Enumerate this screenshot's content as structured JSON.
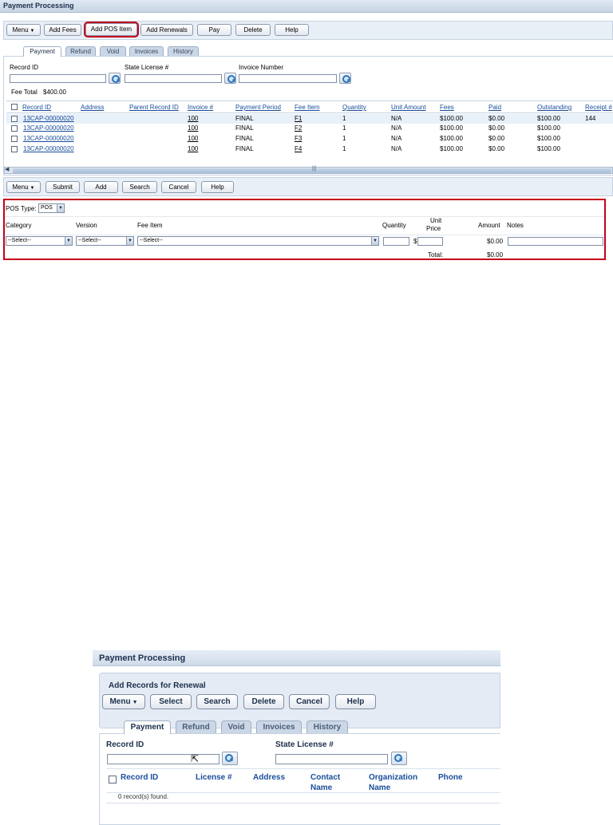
{
  "top": {
    "title": "Payment Processing",
    "toolbar": {
      "menu": "Menu",
      "add_fees": "Add Fees",
      "add_pos_item": "Add POS Item",
      "add_renewals": "Add Renewals",
      "pay": "Pay",
      "delete": "Delete",
      "help": "Help"
    },
    "tabs": [
      "Payment",
      "Refund",
      "Void",
      "Invoices",
      "History"
    ],
    "search": {
      "record_id_label": "Record ID",
      "state_license_label": "State License #",
      "invoice_number_label": "Invoice Number"
    },
    "fee_total_label": "Fee Total",
    "fee_total_value": "$400.00",
    "table": {
      "headers": [
        "Record ID",
        "Address",
        "Parent Record ID",
        "Invoice #",
        "Payment Period",
        "Fee Item",
        "Quantity",
        "Unit Amount",
        "Fees",
        "Paid",
        "Outstanding",
        "Receipt #"
      ],
      "rows": [
        {
          "record_id": "13CAP-00000020",
          "address": "",
          "parent": "",
          "invoice": "100",
          "period": "FINAL",
          "fee_item": "F1",
          "quantity": "1",
          "unit_amount": "N/A",
          "fees": "$100.00",
          "paid": "$0.00",
          "outstanding": "$100.00",
          "receipt": "144"
        },
        {
          "record_id": "13CAP-00000020",
          "address": "",
          "parent": "",
          "invoice": "100",
          "period": "FINAL",
          "fee_item": "F2",
          "quantity": "1",
          "unit_amount": "N/A",
          "fees": "$100.00",
          "paid": "$0.00",
          "outstanding": "$100.00",
          "receipt": ""
        },
        {
          "record_id": "13CAP-00000020",
          "address": "",
          "parent": "",
          "invoice": "100",
          "period": "FINAL",
          "fee_item": "F3",
          "quantity": "1",
          "unit_amount": "N/A",
          "fees": "$100.00",
          "paid": "$0.00",
          "outstanding": "$100.00",
          "receipt": ""
        },
        {
          "record_id": "13CAP-00000020",
          "address": "",
          "parent": "",
          "invoice": "100",
          "period": "FINAL",
          "fee_item": "F4",
          "quantity": "1",
          "unit_amount": "N/A",
          "fees": "$100.00",
          "paid": "$0.00",
          "outstanding": "$100.00",
          "receipt": ""
        }
      ]
    },
    "toolbar2": {
      "menu": "Menu",
      "submit": "Submit",
      "add": "Add",
      "search": "Search",
      "cancel": "Cancel",
      "help": "Help"
    },
    "pos": {
      "type_label": "POS Type:",
      "type_value": "POS",
      "col_category": "Category",
      "col_version": "Version",
      "col_fee_item": "Fee Item",
      "col_quantity": "Quantity",
      "col_unit_price_1": "Unit",
      "col_unit_price_2": "Price",
      "col_amount": "Amount",
      "col_notes": "Notes",
      "category_value": "--Select--",
      "version_value": "--Select--",
      "fee_item_value": "--Select--",
      "currency": "$",
      "amount_value": "$0.00",
      "total_label": "Total:",
      "total_value": "$0.00"
    }
  },
  "bottom": {
    "title": "Payment Processing",
    "subtitle": "Add Records for Renewal",
    "toolbar": {
      "menu": "Menu",
      "select": "Select",
      "search": "Search",
      "delete": "Delete",
      "cancel": "Cancel",
      "help": "Help"
    },
    "tabs": [
      "Payment",
      "Refund",
      "Void",
      "Invoices",
      "History"
    ],
    "record_id_label": "Record ID",
    "state_license_label": "State License #",
    "headers": [
      "Record ID",
      "License #",
      "Address",
      "Contact Name",
      "Organization Name",
      "Phone"
    ],
    "header_lines": {
      "contact_1": "Contact",
      "contact_2": "Name",
      "org_1": "Organization",
      "org_2": "Name"
    },
    "empty_text": "0 record(s) found."
  },
  "colors": {
    "highlight": "#c4001a",
    "link": "#1a4d9a",
    "toolbar_bg": "#e9eff6"
  }
}
